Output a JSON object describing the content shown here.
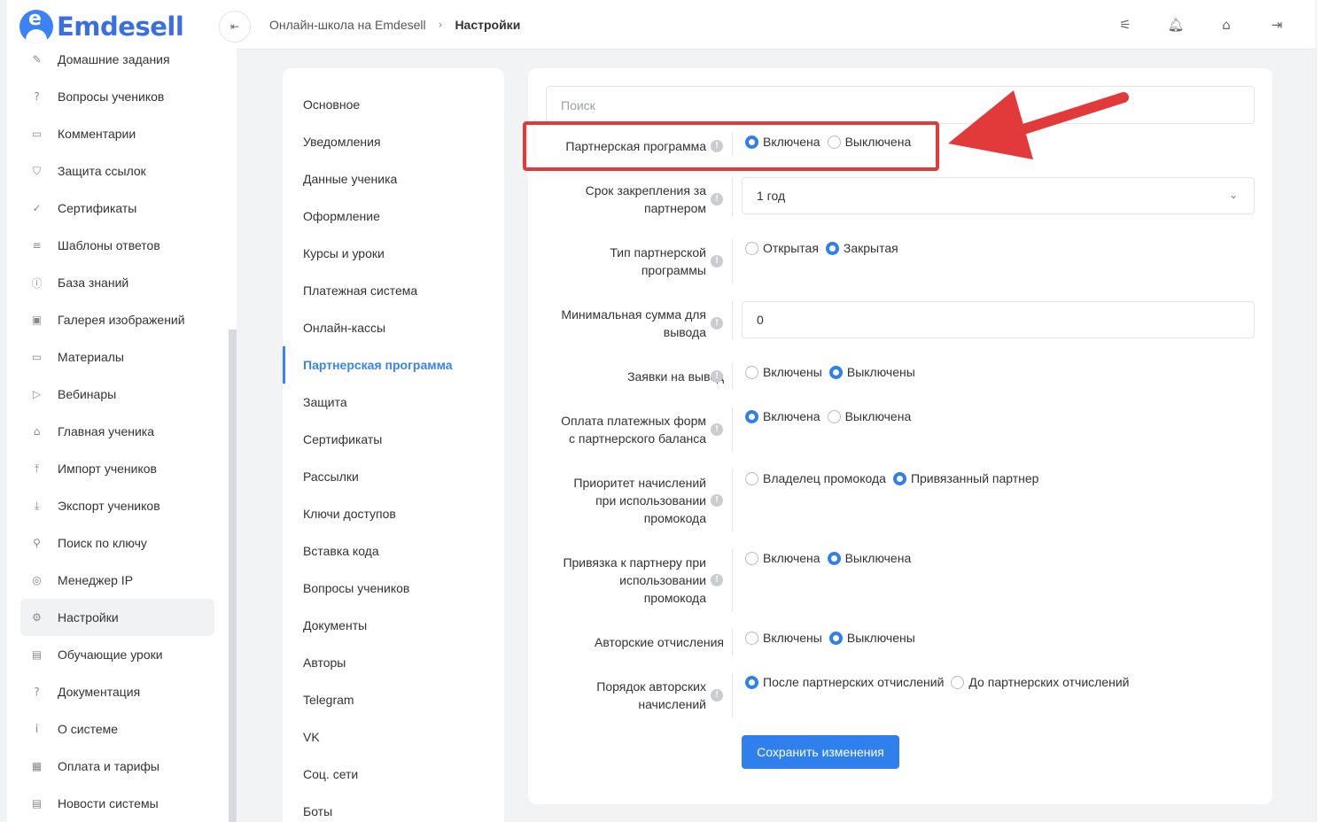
{
  "app": {
    "logo_text": "Emdesell",
    "logo_letter": "e"
  },
  "sidebar": {
    "items": [
      {
        "label": "Домашние задания",
        "icon": "pencil-icon",
        "glyph": "✎"
      },
      {
        "label": "Вопросы учеников",
        "icon": "question-circle-icon",
        "glyph": "?"
      },
      {
        "label": "Комментарии",
        "icon": "comment-icon",
        "glyph": "▭"
      },
      {
        "label": "Защита ссылок",
        "icon": "shield-icon",
        "glyph": "⛉"
      },
      {
        "label": "Сертификаты",
        "icon": "certificate-icon",
        "glyph": "✓"
      },
      {
        "label": "Шаблоны ответов",
        "icon": "list-icon",
        "glyph": "≡"
      },
      {
        "label": "База знаний",
        "icon": "info-icon",
        "glyph": "ⓘ"
      },
      {
        "label": "Галерея изображений",
        "icon": "image-icon",
        "glyph": "▣"
      },
      {
        "label": "Материалы",
        "icon": "folder-icon",
        "glyph": "▭"
      },
      {
        "label": "Вебинары",
        "icon": "play-icon",
        "glyph": "▷"
      },
      {
        "label": "Главная ученика",
        "icon": "home-icon",
        "glyph": "⌂"
      },
      {
        "label": "Импорт учеников",
        "icon": "upload-icon",
        "glyph": "⤒"
      },
      {
        "label": "Экспорт учеников",
        "icon": "download-icon",
        "glyph": "⤓"
      },
      {
        "label": "Поиск по ключу",
        "icon": "search-icon",
        "glyph": "⚲"
      },
      {
        "label": "Менеджер IP",
        "icon": "target-icon",
        "glyph": "◎"
      },
      {
        "label": "Настройки",
        "icon": "gear-icon",
        "glyph": "⚙"
      },
      {
        "label": "Обучающие уроки",
        "icon": "film-icon",
        "glyph": "▤"
      },
      {
        "label": "Документация",
        "icon": "help-square-icon",
        "glyph": "?"
      },
      {
        "label": "О системе",
        "icon": "info-square-icon",
        "glyph": "i"
      },
      {
        "label": "Оплата и тарифы",
        "icon": "receipt-icon",
        "glyph": "▦"
      },
      {
        "label": "Новости системы",
        "icon": "news-icon",
        "glyph": "▤"
      }
    ],
    "active_index": 15
  },
  "header": {
    "collapse_glyph": "⇤",
    "breadcrumb_link": "Онлайн-школа на Emdesell",
    "breadcrumb_sep": "›",
    "breadcrumb_current": "Настройки",
    "icons": [
      {
        "name": "sliders-icon",
        "glyph": "⚟"
      },
      {
        "name": "bell-icon",
        "glyph": "🔔︎"
      },
      {
        "name": "home-settings-icon",
        "glyph": "⌂"
      },
      {
        "name": "logout-icon",
        "glyph": "⇥"
      }
    ]
  },
  "settings_nav": {
    "items": [
      "Основное",
      "Уведомления",
      "Данные ученика",
      "Оформление",
      "Курсы и уроки",
      "Платежная система",
      "Онлайн-кассы",
      "Партнерская программа",
      "Защита",
      "Сертификаты",
      "Рассылки",
      "Ключи доступов",
      "Вставка кода",
      "Вопросы учеников",
      "Документы",
      "Авторы",
      "Telegram",
      "VK",
      "Соц. сети",
      "Боты"
    ],
    "active_index": 7
  },
  "form": {
    "search_placeholder": "Поиск",
    "info_glyph": "!",
    "partner_program": {
      "label": "Партнерская программа",
      "options": [
        "Включена",
        "Выключена"
      ],
      "selected": 0
    },
    "binding_period": {
      "label": "Срок закрепления за партнером",
      "value": "1 год",
      "chevron": "⌄"
    },
    "program_type": {
      "label": "Тип партнерской программы",
      "options": [
        "Открытая",
        "Закрытая"
      ],
      "selected": 1
    },
    "min_withdraw": {
      "label": "Минимальная сумма для вывода",
      "value": "0"
    },
    "withdraw_requests": {
      "label": "Заявки на вывод",
      "options": [
        "Включены",
        "Выключены"
      ],
      "selected": 1
    },
    "pay_from_balance": {
      "label": "Оплата платежных форм с партнерского баланса",
      "options": [
        "Включена",
        "Выключена"
      ],
      "selected": 0
    },
    "promo_priority": {
      "label": "Приоритет начислений при использовании промокода",
      "options": [
        "Владелец промокода",
        "Привязанный партнер"
      ],
      "selected": 1
    },
    "promo_binding": {
      "label": "Привязка к партнеру при использовании промокода",
      "options": [
        "Включена",
        "Выключена"
      ],
      "selected": 1
    },
    "author_fees": {
      "label": "Авторские отчисления",
      "options": [
        "Включены",
        "Выключены"
      ],
      "selected": 1
    },
    "author_order": {
      "label": "Порядок авторских начислений",
      "options": [
        "После партнерских отчислений",
        "До партнерских отчислений"
      ],
      "selected": 0
    },
    "save_label": "Сохранить изменения"
  },
  "colors": {
    "accent": "#2f80ed",
    "annotation": "#e23a3a",
    "logo": "#3b6fe0"
  }
}
